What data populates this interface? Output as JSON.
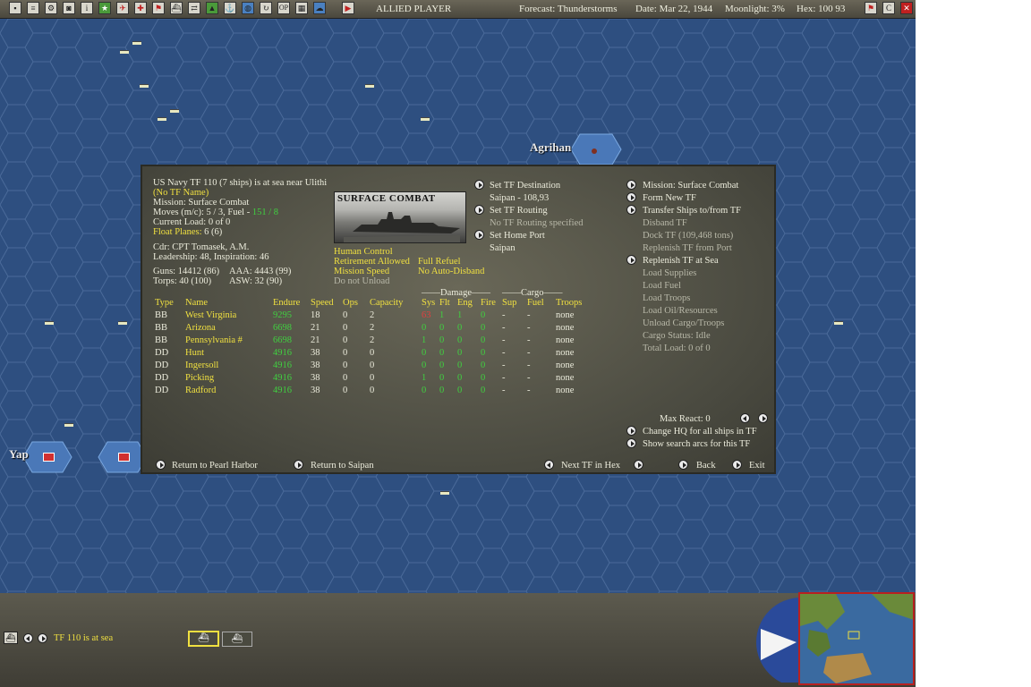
{
  "topbar": {
    "player": "ALLIED PLAYER",
    "forecast": "Forecast: Thunderstorms",
    "date": "Date: Mar 22, 1944",
    "moonlight": "Moonlight: 3%",
    "hex": "Hex: 100 93"
  },
  "map": {
    "places": [
      "Agrihan",
      "Yap"
    ]
  },
  "tf": {
    "header": "US Navy TF 110 (7 ships) is at sea near Ulithi",
    "name": "(No TF Name)",
    "mission": "Mission: Surface Combat",
    "moves_prefix": "Moves (m/c): 5 / 3, Fuel - ",
    "moves_fuel": "151 / 8",
    "current_load": "Current Load: 0 of 0",
    "float_label": "Float Planes:",
    "float_value": " 6 (6)",
    "cdr": "Cdr: CPT  Tomasek, A.M.",
    "leadership": "Leadership: 48, Inspiration: 46",
    "guns": "Guns: 14412 (86)",
    "aaa": "AAA: 4443 (99)",
    "torps": "Torps: 40 (100)",
    "asw": "ASW: 32 (90)",
    "image_title": "SURFACE COMBAT",
    "human_control": "Human Control",
    "retirement": "Retirement Allowed",
    "full_refuel": "Full Refuel",
    "mission_speed": "Mission Speed",
    "no_auto_disband": "No Auto-Disband",
    "do_not_unload": "Do not Unload"
  },
  "routing": {
    "set_destination": "Set TF Destination",
    "destination_value": "Saipan - 108,93",
    "set_routing": "Set TF Routing",
    "routing_value": "No TF Routing specified",
    "set_home": "Set Home Port",
    "home_value": "Saipan"
  },
  "actions": {
    "mission": "Mission: Surface Combat",
    "form_new": "Form New TF",
    "transfer": "Transfer Ships to/from TF",
    "disband": "Disband TF",
    "dock": "Dock TF (109,468 tons)",
    "replenish_port": "Replenish TF from Port",
    "replenish_sea": "Replenish TF at Sea",
    "load_supplies": "Load Supplies",
    "load_fuel": "Load Fuel",
    "load_troops": "Load Troops",
    "load_oil": "Load Oil/Resources",
    "unload": "Unload Cargo/Troops",
    "cargo_status": "Cargo Status: Idle",
    "total_load": "Total Load: 0 of 0"
  },
  "table": {
    "group_damage": "Damage",
    "group_cargo": "Cargo",
    "headers": [
      "Type",
      "Name",
      "Endure",
      "Speed",
      "Ops",
      "Capacity",
      "Sys",
      "Flt",
      "Eng",
      "Fire",
      "Sup",
      "Fuel",
      "Troops"
    ],
    "rows": [
      [
        "BB",
        "West Virginia",
        "9295",
        "18",
        "0",
        "2",
        "63",
        "1",
        "1",
        "0",
        "-",
        "-",
        "none"
      ],
      [
        "BB",
        "Arizona",
        "6698",
        "21",
        "0",
        "2",
        "0",
        "0",
        "0",
        "0",
        "-",
        "-",
        "none"
      ],
      [
        "BB",
        "Pennsylvania #",
        "6698",
        "21",
        "0",
        "2",
        "1",
        "0",
        "0",
        "0",
        "-",
        "-",
        "none"
      ],
      [
        "DD",
        "Hunt",
        "4916",
        "38",
        "0",
        "0",
        "0",
        "0",
        "0",
        "0",
        "-",
        "-",
        "none"
      ],
      [
        "DD",
        "Ingersoll",
        "4916",
        "38",
        "0",
        "0",
        "0",
        "0",
        "0",
        "0",
        "-",
        "-",
        "none"
      ],
      [
        "DD",
        "Picking",
        "4916",
        "38",
        "0",
        "0",
        "1",
        "0",
        "0",
        "0",
        "-",
        "-",
        "none"
      ],
      [
        "DD",
        "Radford",
        "4916",
        "38",
        "0",
        "0",
        "0",
        "0",
        "0",
        "0",
        "-",
        "-",
        "none"
      ]
    ]
  },
  "footer": {
    "max_react": "Max React: 0",
    "change_hq": "Change HQ for all ships in TF",
    "show_arcs": "Show search arcs for this TF",
    "return_pearl": "Return to Pearl Harbor",
    "return_saipan": "Return to Saipan",
    "next_tf": "Next TF in Hex",
    "back": "Back",
    "exit": "Exit"
  },
  "bottom": {
    "status": "TF 110 is at sea"
  },
  "colors": {
    "sea": "#2e4f80",
    "panel": "#55544a",
    "ship_name": "#f0e040",
    "value_green": "#40d040",
    "damage_red": "#e04040"
  }
}
